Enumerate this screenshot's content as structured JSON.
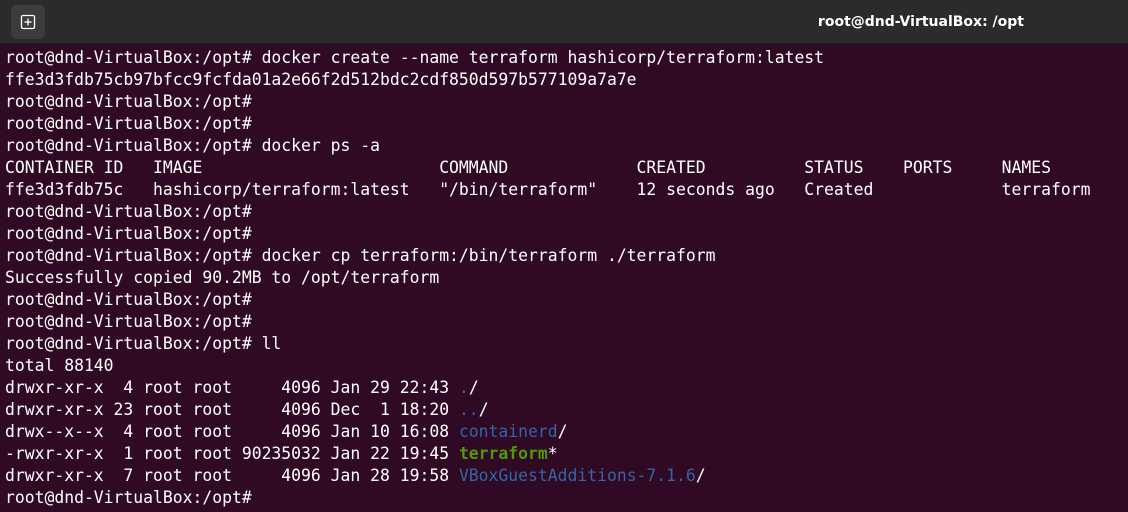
{
  "window": {
    "title": "root@dnd-VirtualBox: /opt",
    "new_tab_icon": "new-tab-icon"
  },
  "colors": {
    "background": "#300a24",
    "titlebar": "#2b2b2b",
    "text": "#ffffff",
    "directory": "#3465a4",
    "executable": "#4e9a06"
  },
  "terminal": {
    "lines": [
      [
        {
          "text": "root@dnd-VirtualBox:/opt# docker create --name terraform hashicorp/terraform:latest",
          "type": "prompt"
        }
      ],
      [
        {
          "text": "ffe3d3fdb75cb97bfcc9fcfda01a2e66f2d512bdc2cdf850d597b577109a7a7e",
          "type": "output"
        }
      ],
      [
        {
          "text": "root@dnd-VirtualBox:/opt#",
          "type": "prompt"
        }
      ],
      [
        {
          "text": "root@dnd-VirtualBox:/opt#",
          "type": "prompt"
        }
      ],
      [
        {
          "text": "root@dnd-VirtualBox:/opt# docker ps -a",
          "type": "prompt"
        }
      ],
      [
        {
          "text": "CONTAINER ID   IMAGE                        COMMAND             CREATED          STATUS    PORTS     NAMES",
          "type": "output"
        }
      ],
      [
        {
          "text": "ffe3d3fdb75c   hashicorp/terraform:latest   \"/bin/terraform\"    12 seconds ago   Created             terraform",
          "type": "output"
        }
      ],
      [
        {
          "text": "root@dnd-VirtualBox:/opt#",
          "type": "prompt"
        }
      ],
      [
        {
          "text": "root@dnd-VirtualBox:/opt#",
          "type": "prompt"
        }
      ],
      [
        {
          "text": "root@dnd-VirtualBox:/opt# docker cp terraform:/bin/terraform ./terraform",
          "type": "prompt"
        }
      ],
      [
        {
          "text": "Successfully copied 90.2MB to /opt/terraform",
          "type": "output"
        }
      ],
      [
        {
          "text": "root@dnd-VirtualBox:/opt#",
          "type": "prompt"
        }
      ],
      [
        {
          "text": "root@dnd-VirtualBox:/opt#",
          "type": "prompt"
        }
      ],
      [
        {
          "text": "root@dnd-VirtualBox:/opt# ll",
          "type": "prompt"
        }
      ],
      [
        {
          "text": "total 88140",
          "type": "output"
        }
      ],
      [
        {
          "text": "drwxr-xr-x  4 root root     4096 Jan 29 22:43 ",
          "type": "output"
        },
        {
          "text": ".",
          "type": "dir"
        },
        {
          "text": "/",
          "type": "output"
        }
      ],
      [
        {
          "text": "drwxr-xr-x 23 root root     4096 Dec  1 18:20 ",
          "type": "output"
        },
        {
          "text": "..",
          "type": "dir"
        },
        {
          "text": "/",
          "type": "output"
        }
      ],
      [
        {
          "text": "drwx--x--x  4 root root     4096 Jan 10 16:08 ",
          "type": "output"
        },
        {
          "text": "containerd",
          "type": "dir"
        },
        {
          "text": "/",
          "type": "output"
        }
      ],
      [
        {
          "text": "-rwxr-xr-x  1 root root 90235032 Jan 22 19:45 ",
          "type": "output"
        },
        {
          "text": "terraform",
          "type": "exec"
        },
        {
          "text": "*",
          "type": "output"
        }
      ],
      [
        {
          "text": "drwxr-xr-x  7 root root     4096 Jan 28 19:58 ",
          "type": "output"
        },
        {
          "text": "VBoxGuestAdditions-7.1.6",
          "type": "dir"
        },
        {
          "text": "/",
          "type": "output"
        }
      ],
      [
        {
          "text": "root@dnd-VirtualBox:/opt#",
          "type": "prompt"
        }
      ]
    ]
  }
}
